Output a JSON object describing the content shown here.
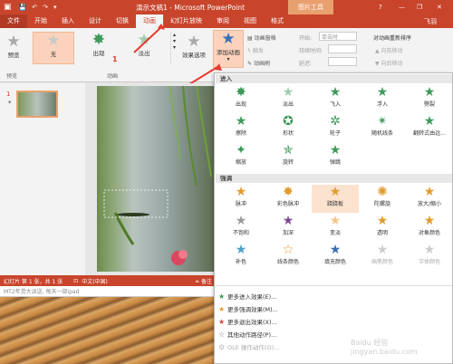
{
  "title_bar": {
    "title": "演示文稿1 - Microsoft PowerPoint",
    "tools_tab": "图片工具",
    "help": "?",
    "minimize": "—",
    "restore": "❐",
    "close": "✕"
  },
  "tabs": [
    "文件",
    "开始",
    "插入",
    "设计",
    "切换",
    "动画",
    "幻灯片放映",
    "审阅",
    "视图",
    "格式"
  ],
  "user": "飞羽",
  "ribbon": {
    "preview": "预览",
    "preview_group": "预览",
    "effects": [
      "无",
      "出现",
      "淡出"
    ],
    "effect_options": "效果选项",
    "animation_group": "动画",
    "add_animation": "添加动画",
    "pane": "动画窗格",
    "trigger": "触发",
    "painter": "动画刷",
    "start_label": "开始:",
    "start_value": "单击时",
    "duration_label": "持续时间:",
    "delay_label": "延迟:",
    "reorder": "对动画重新排序",
    "forward": "向前移动",
    "backward": "向后移动"
  },
  "callouts": {
    "one": "1",
    "two": "2"
  },
  "slide_number": "1",
  "status": {
    "slide": "幻灯片 第 1 张，共 1 张",
    "lang": "中文(中国)",
    "notes": "备注"
  },
  "notes_text": "MT2年货大派送, 每天一部ipad",
  "dropdown": {
    "entrance_title": "进入",
    "entrance": [
      "出现",
      "淡出",
      "飞入",
      "浮入",
      "劈裂",
      "擦除",
      "形状",
      "轮子",
      "随机线条",
      "翻转式由远...",
      "缩放",
      "旋转",
      "弹跳"
    ],
    "emphasis_title": "强调",
    "emphasis": [
      "脉冲",
      "彩色脉冲",
      "跷跷板",
      "陀螺旋",
      "放大/缩小",
      "不饱和",
      "加深",
      "变淡",
      "透明",
      "对象颜色",
      "补色",
      "线条颜色",
      "填充颜色",
      "画笔颜色",
      "字体颜色"
    ],
    "more": [
      "更多进入效果(E)...",
      "更多强调效果(M)...",
      "更多退出效果(X)...",
      "其他动作路径(P)...",
      "OLE 操作动作(O)..."
    ]
  },
  "watermark": "Baidu 经验 jingyan.baidu.com"
}
